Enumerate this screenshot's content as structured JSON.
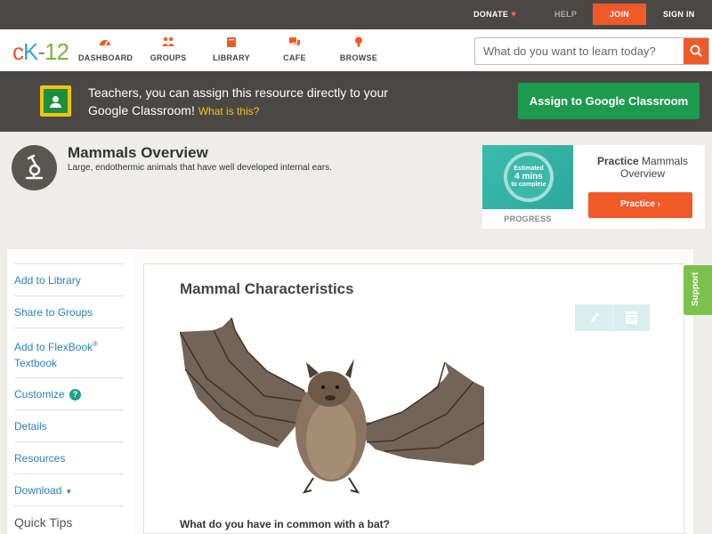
{
  "topbar": {
    "donate": "DONATE",
    "help": "HELP",
    "join": "JOIN",
    "signin": "SIGN IN"
  },
  "header": {
    "logo": {
      "c": "c",
      "k": "K",
      "dash": "-",
      "n": "12"
    },
    "nav": {
      "dashboard": "DASHBOARD",
      "groups": "GROUPS",
      "library": "LIBRARY",
      "cafe": "CAFE",
      "browse": "BROWSE"
    },
    "search": {
      "placeholder": "What do you want to learn today?"
    }
  },
  "banner": {
    "text": "Teachers, you can assign this resource directly to your Google Classroom!",
    "what_link": "What is this?",
    "assign_button": "Assign to Google Classroom"
  },
  "concept": {
    "title": "Mammals Overview",
    "description": "Large, endothermic animals that have well developed internal ears."
  },
  "practice": {
    "progress_circle": {
      "line1": "Estimated",
      "line2": "4 mins",
      "line3": "to complete"
    },
    "progress_label": "PROGRESS",
    "title_bold": "Practice",
    "title_rest": "Mammals Overview",
    "button": "Practice"
  },
  "sidebar": {
    "add_to_library": "Add to Library",
    "share_to_groups": "Share to Groups",
    "add_to_flexbook": "Add to FlexBook",
    "flexbook_reg": "®",
    "textbook": "Textbook",
    "customize": "Customize",
    "customize_help": "?",
    "details": "Details",
    "resources": "Resources",
    "download": "Download",
    "quick_tips": "Quick Tips"
  },
  "main": {
    "section_title": "Mammal Characteristics",
    "question": "What do you have in common with a bat?"
  },
  "support": "Support",
  "colors": {
    "accent_orange": "#f05a28",
    "dark_bar": "#4a4845",
    "green_button": "#1e9a4e",
    "link_blue": "#2a7fba",
    "support_green": "#7cc04e"
  },
  "icons": [
    "heart-icon",
    "dashboard-icon",
    "groups-icon",
    "library-icon",
    "cafe-icon",
    "browse-icon",
    "search-icon",
    "google-classroom-icon",
    "microscope-icon",
    "chevron-right-icon",
    "help-icon",
    "caret-down-icon",
    "pencil-icon",
    "notes-icon"
  ]
}
